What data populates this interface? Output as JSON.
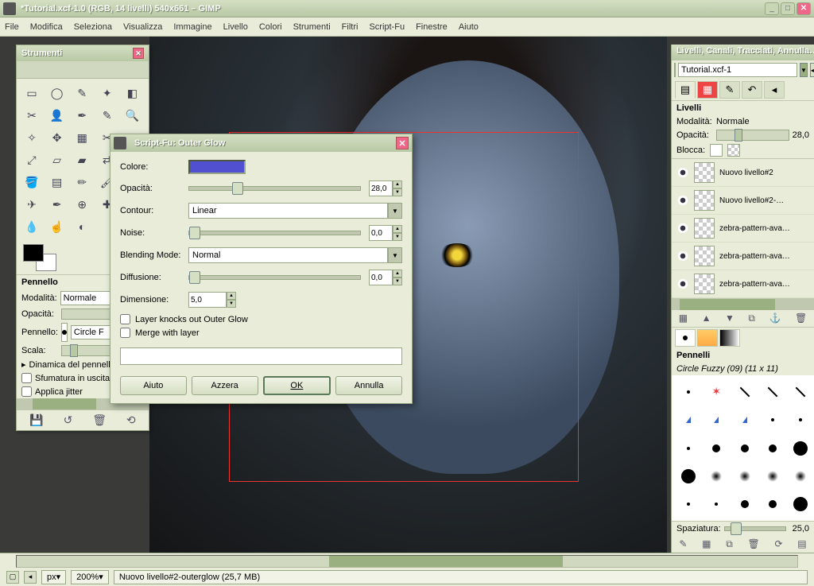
{
  "window": {
    "title": "*Tutorial.xcf-1.0 (RGB, 14 livelli) 540x661 – GIMP"
  },
  "menu": [
    "File",
    "Modifica",
    "Seleziona",
    "Visualizza",
    "Immagine",
    "Livello",
    "Colori",
    "Strumenti",
    "Filtri",
    "Script-Fu",
    "Finestre",
    "Aiuto"
  ],
  "toolbox": {
    "title": "Strumenti",
    "section": "Pennello",
    "mode_label": "Modalità:",
    "mode_value": "Normale",
    "opacity_label": "Opacità:",
    "brush_label": "Pennello:",
    "brush_value": "Circle F",
    "scale_label": "Scala:",
    "dyn": "Dinamica del pennello",
    "fade": "Sfumatura in uscita",
    "jitter": "Applica jitter"
  },
  "dialog": {
    "title": "Script-Fu: Outer Glow",
    "color_label": "Colore:",
    "opacity_label": "Opacità:",
    "opacity_value": "28,0",
    "contour_label": "Contour:",
    "contour_value": "Linear",
    "noise_label": "Noise:",
    "noise_value": "0,0",
    "blend_label": "Blending Mode:",
    "blend_value": "Normal",
    "diff_label": "Diffusione:",
    "diff_value": "0,0",
    "size_label": "Dimensione:",
    "size_value": "5,0",
    "knock": "Layer knocks out Outer Glow",
    "merge": "Merge with layer",
    "btn_help": "Aiuto",
    "btn_reset": "Azzera",
    "btn_ok": "OK",
    "btn_cancel": "Annulla"
  },
  "layers": {
    "title": "Livelli, Canali, Tracciati, Annulla…",
    "image": "Tutorial.xcf-1",
    "section": "Livelli",
    "mode_label": "Modalità:",
    "mode_value": "Normale",
    "opacity_label": "Opacità:",
    "opacity_value": "28,0",
    "lock_label": "Blocca:",
    "items": [
      {
        "name": "Nuovo livello#2"
      },
      {
        "name": "Nuovo livello#2-…"
      },
      {
        "name": "zebra-pattern-ava…"
      },
      {
        "name": "zebra-pattern-ava…"
      },
      {
        "name": "zebra-pattern-ava…"
      }
    ]
  },
  "brushes": {
    "section": "Pennelli",
    "info": "Circle Fuzzy (09) (11 x 11)",
    "spacing_label": "Spaziatura:",
    "spacing_value": "25,0"
  },
  "status": {
    "unit": "px",
    "zoom": "200%",
    "text": "Nuovo livello#2-outerglow (25,7 MB)"
  }
}
